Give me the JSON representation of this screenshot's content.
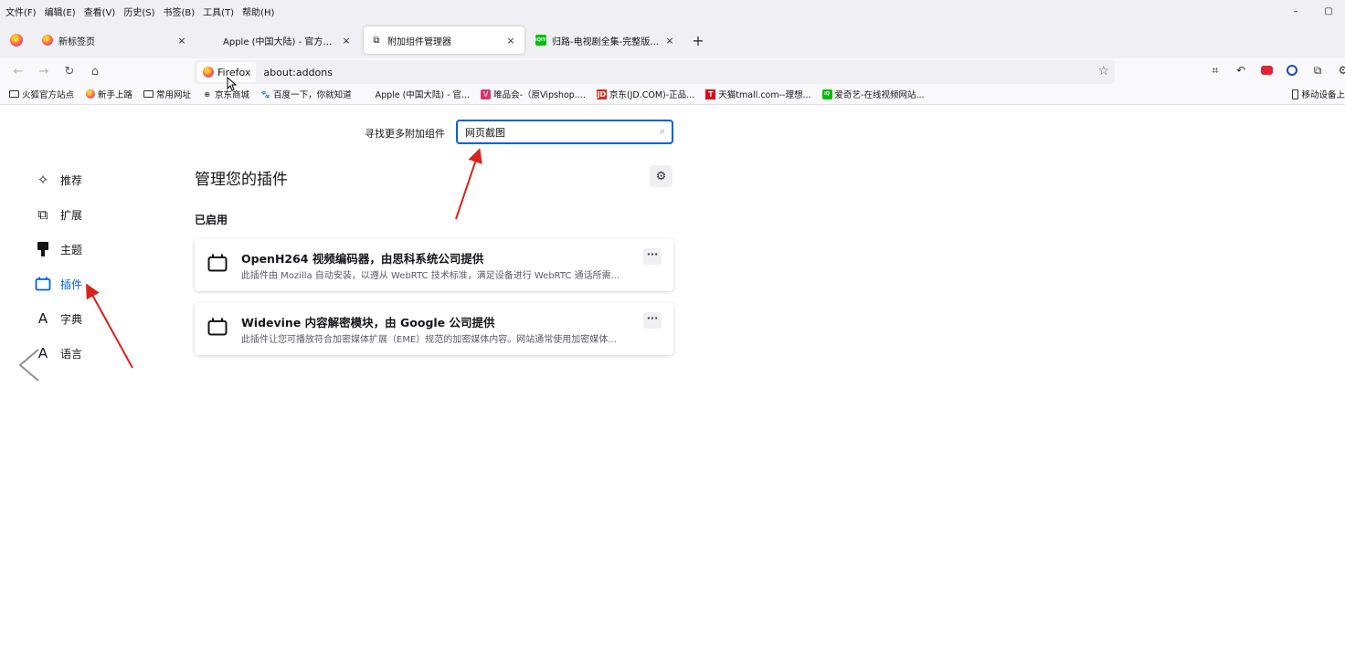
{
  "menu": [
    "文件(F)",
    "编辑(E)",
    "查看(V)",
    "历史(S)",
    "书签(B)",
    "工具(T)",
    "帮助(H)"
  ],
  "window_controls": {
    "minimize": "–",
    "restore": "▢"
  },
  "tabs": [
    {
      "title": "新标签页",
      "icon": "firefox-icon"
    },
    {
      "title": "Apple (中国大陆) - 官方网站",
      "icon": "apple-icon"
    },
    {
      "title": "附加组件管理器",
      "icon": "puzzle-icon",
      "active": true
    },
    {
      "title": "归路-电视剧全集-完整版视频在线观看",
      "icon": "iqiyi-icon"
    }
  ],
  "tab_icon_texts": {
    "apple": "",
    "puzzle": "⧉",
    "iqiyi": "iQIYI"
  },
  "tab_close": "×",
  "new_tab": "+",
  "nav": {
    "back": "←",
    "forward": "→",
    "reload": "↻",
    "home": "⌂"
  },
  "urlbar": {
    "identity_label": "Firefox",
    "url": "about:addons",
    "star": "☆"
  },
  "toolbar_icons": {
    "crop": "⌗",
    "undo": "↶",
    "puzzle": "⧉",
    "extensions": "⚙"
  },
  "bookmarks": [
    {
      "label": "火狐官方站点",
      "icon": "folder"
    },
    {
      "label": "新手上路",
      "icon": "firefox"
    },
    {
      "label": "常用网址",
      "icon": "folder"
    },
    {
      "label": "京东商城",
      "icon": "globe"
    },
    {
      "label": "百度一下，你就知道",
      "icon": "baidu"
    },
    {
      "label": "Apple (中国大陆) - 官...",
      "icon": "apple"
    },
    {
      "label": "唯品会-（原Vipshop....",
      "icon": "vip"
    },
    {
      "label": "京东(JD.COM)-正品...",
      "icon": "jd"
    },
    {
      "label": "天猫tmall.com--理想...",
      "icon": "tmall"
    },
    {
      "label": "爱奇艺-在线视频网站...",
      "icon": "iqiyi"
    }
  ],
  "bookmark_icon_texts": {
    "globe": "⊕",
    "baidu": "🐾",
    "apple": "",
    "vip": "V",
    "jd": "JD",
    "tmall": "T",
    "iqiyi": "iQ"
  },
  "mobile_bookmarks": "移动设备上",
  "search": {
    "label": "寻找更多附加组件",
    "value": "网页截图",
    "icon": "⌕"
  },
  "categories": [
    {
      "label": "推荐",
      "icon": "sparkle-icon",
      "glyph": "✧"
    },
    {
      "label": "扩展",
      "icon": "puzzle-icon",
      "glyph": "⧉"
    },
    {
      "label": "主题",
      "icon": "brush-icon",
      "glyph": "▮"
    },
    {
      "label": "插件",
      "icon": "plugin-icon",
      "glyph": "",
      "selected": true
    },
    {
      "label": "字典",
      "icon": "dictionary-icon",
      "glyph": "A"
    },
    {
      "label": "语言",
      "icon": "language-icon",
      "glyph": "A"
    }
  ],
  "main": {
    "title": "管理您的插件",
    "gear": "⚙",
    "section_enabled": "已启用"
  },
  "plugins": [
    {
      "name": "OpenH264 视频编码器，由思科系统公司提供",
      "description": "此插件由 Mozilla 自动安装，以遵从 WebRTC 技术标准，满足设备进行 WebRTC 通话所需...",
      "more": "···"
    },
    {
      "name": "Widevine 内容解密模块，由 Google 公司提供",
      "description": "此插件让您可播放符合加密媒体扩展（EME）规范的加密媒体内容。网站通常使用加密媒体...",
      "more": "···"
    }
  ],
  "colors": {
    "accent": "#0061e0",
    "annotation_arrow": "#d9221c"
  }
}
